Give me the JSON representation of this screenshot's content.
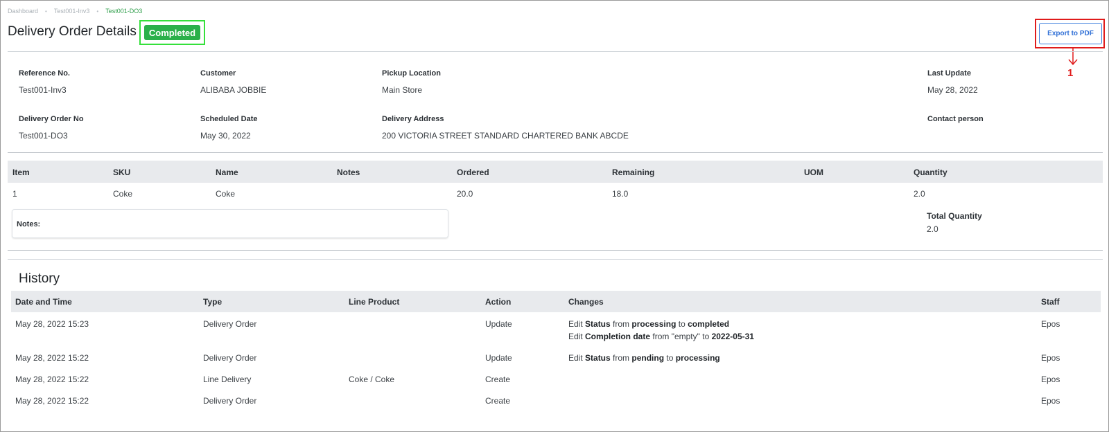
{
  "breadcrumb": [
    "Dashboard",
    "Test001-Inv3",
    "Test001-DO3"
  ],
  "breadcrumb_sep": "•",
  "header": {
    "title": "Delivery Order Details",
    "status": "Completed",
    "export_label": "Export to PDF",
    "annotation_number": "1"
  },
  "details": {
    "reference_no": {
      "label": "Reference No.",
      "value": "Test001-Inv3"
    },
    "customer": {
      "label": "Customer",
      "value": "ALIBABA JOBBIE"
    },
    "pickup_location": {
      "label": "Pickup Location",
      "value": "Main Store"
    },
    "last_update": {
      "label": "Last Update",
      "value": "May 28, 2022"
    },
    "delivery_order_no": {
      "label": "Delivery Order No",
      "value": "Test001-DO3"
    },
    "scheduled_date": {
      "label": "Scheduled Date",
      "value": "May 30, 2022"
    },
    "delivery_address": {
      "label": "Delivery Address",
      "value": "200 VICTORIA STREET STANDARD CHARTERED BANK ABCDE"
    },
    "contact_person": {
      "label": "Contact person",
      "value": ""
    }
  },
  "items": {
    "headers": [
      "Item",
      "SKU",
      "Name",
      "Notes",
      "Ordered",
      "Remaining",
      "UOM",
      "Quantity"
    ],
    "rows": [
      [
        "1",
        "Coke",
        "Coke",
        "",
        "20.0",
        "18.0",
        "",
        "2.0"
      ]
    ],
    "notes_label": "Notes:",
    "total_quantity_label": "Total Quantity",
    "total_quantity_value": "2.0"
  },
  "history": {
    "title": "History",
    "headers": [
      "Date and Time",
      "Type",
      "Line Product",
      "Action",
      "Changes",
      "Staff"
    ],
    "rows": [
      {
        "date": "May 28, 2022 15:23",
        "type": "Delivery Order",
        "product": "",
        "action": "Update",
        "changes": [
          [
            "Edit ",
            "Status",
            " from ",
            "processing",
            " to ",
            "completed"
          ],
          [
            "Edit ",
            "Completion date",
            " from \"empty\" to ",
            "2022-05-31",
            "",
            ""
          ]
        ],
        "staff": "Epos"
      },
      {
        "date": "May 28, 2022 15:22",
        "type": "Delivery Order",
        "product": "",
        "action": "Update",
        "changes": [
          [
            "Edit ",
            "Status",
            " from ",
            "pending",
            " to ",
            "processing"
          ]
        ],
        "staff": "Epos"
      },
      {
        "date": "May 28, 2022 15:22",
        "type": "Line Delivery",
        "product": "Coke / Coke",
        "action": "Create",
        "changes": [],
        "staff": "Epos"
      },
      {
        "date": "May 28, 2022 15:22",
        "type": "Delivery Order",
        "product": "",
        "action": "Create",
        "changes": [],
        "staff": "Epos"
      }
    ]
  },
  "colors": {
    "status_badge": "#2bb04a",
    "badge_highlight": "#35e03b",
    "annotation": "#e01b1b",
    "button_blue": "#2f6fd6"
  }
}
